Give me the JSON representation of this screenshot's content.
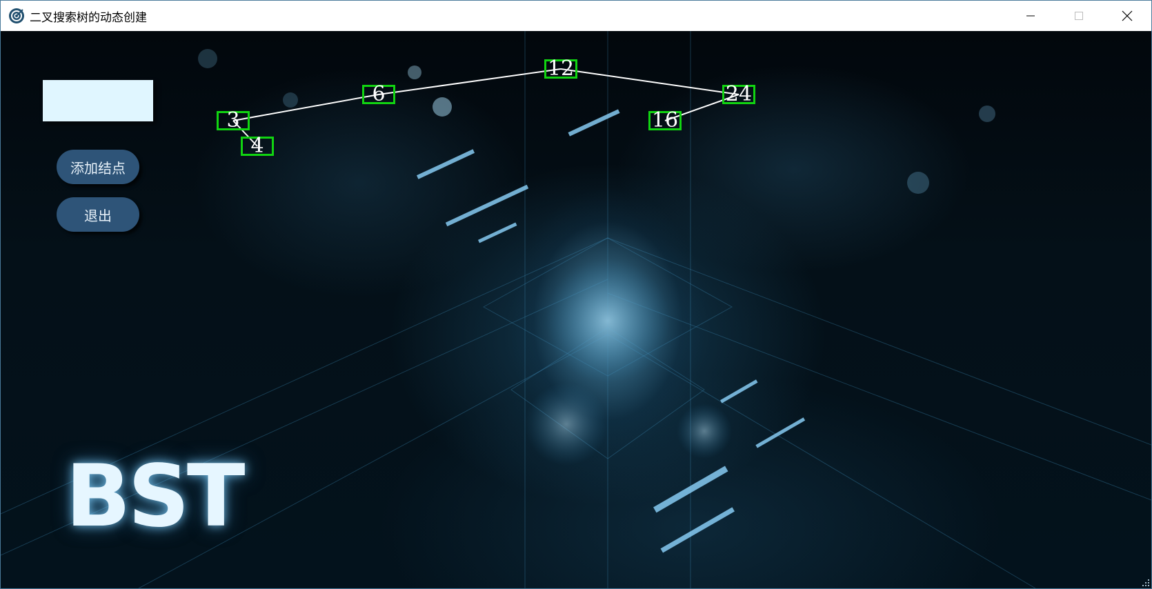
{
  "window": {
    "title": "二叉搜索树的动态创建",
    "controls": [
      "minimize-icon",
      "maximize-icon",
      "close-icon"
    ]
  },
  "sidebar": {
    "input_value": "",
    "add_button_label": "添加结点",
    "exit_button_label": "退出"
  },
  "banner": {
    "text": "BST"
  },
  "tree": {
    "nodes": [
      {
        "id": "n12",
        "value": "12"
      },
      {
        "id": "n6",
        "value": "6"
      },
      {
        "id": "n24",
        "value": "24"
      },
      {
        "id": "n3",
        "value": "3"
      },
      {
        "id": "n16",
        "value": "16"
      },
      {
        "id": "n4",
        "value": "4"
      }
    ],
    "edges": [
      [
        "n12",
        "n6"
      ],
      [
        "n12",
        "n24"
      ],
      [
        "n6",
        "n3"
      ],
      [
        "n24",
        "n16"
      ],
      [
        "n3",
        "n4"
      ]
    ],
    "node_border_color": "#11d411",
    "edge_color": "#ffffff"
  }
}
